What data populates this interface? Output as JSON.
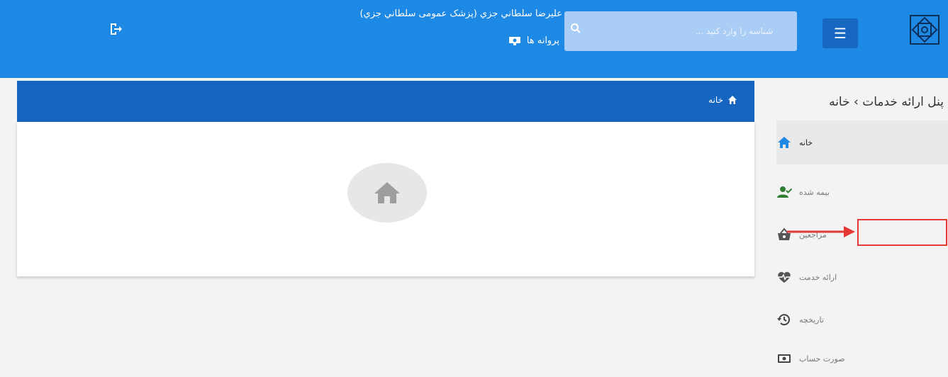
{
  "header": {
    "user_name": "عليرضا سلطاني جزي (پزشک عمومی سلطاني جزي)",
    "licenses_label": "پروانه ها",
    "search_placeholder": "شناسه را وارد کنید ..."
  },
  "breadcrumb": "پنل ارائه خدمات › خانه",
  "panel": {
    "title": "خانه"
  },
  "sidebar": {
    "items": [
      {
        "label": "خانه",
        "icon": "home-icon",
        "active": true
      },
      {
        "label": "بیمه شده",
        "icon": "person-check-icon"
      },
      {
        "label": "مراجعین",
        "icon": "basket-icon"
      },
      {
        "label": "ارائه خدمت",
        "icon": "heart-pulse-icon"
      },
      {
        "label": "تاریخچه",
        "icon": "history-icon"
      },
      {
        "label": "صورت حساب",
        "icon": "money-icon"
      }
    ]
  },
  "colors": {
    "topbar": "#1e88e5",
    "panel_header": "#1665c0",
    "highlight": "#e53935"
  }
}
